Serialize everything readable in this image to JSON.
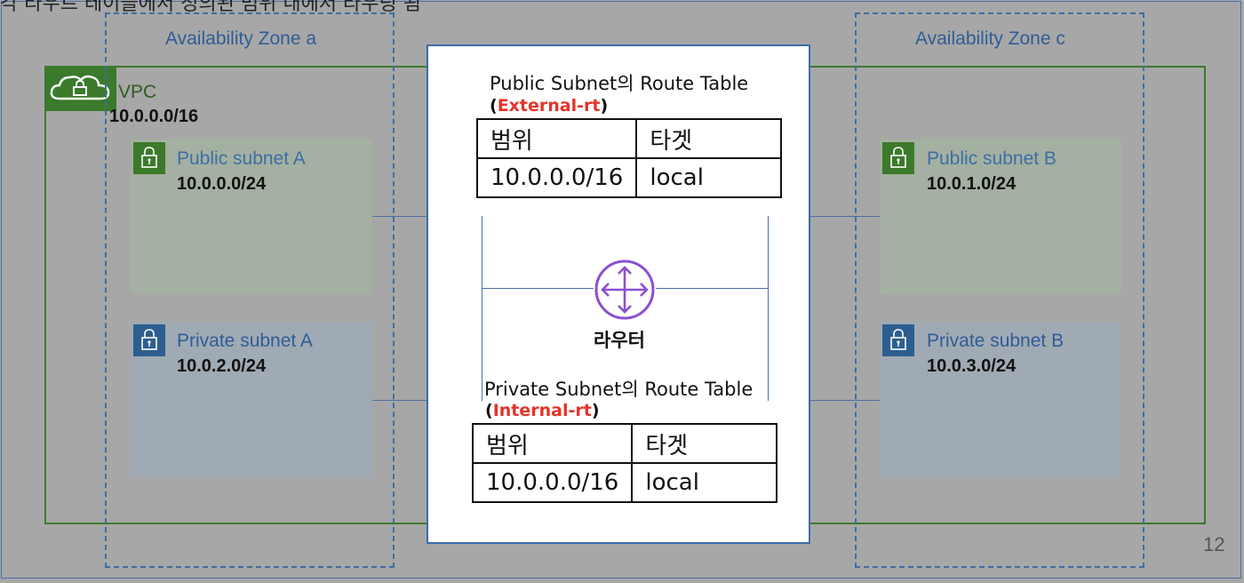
{
  "header": {
    "text": "각 라우트 테이블에서 정의된 범위 내에서 라우팅 됨"
  },
  "zones": [
    {
      "label": "Availability Zone a"
    },
    {
      "label": "Availability Zone c"
    }
  ],
  "vpc": {
    "label": "VPC",
    "cidr": "10.0.0.0/16",
    "icon": "vpc-cloud-lock-icon"
  },
  "subnets": [
    {
      "label": "Public subnet A",
      "cidr": "10.0.0.0/24",
      "icon": "lock-icon"
    },
    {
      "label": "Private subnet A",
      "cidr": "10.0.2.0/24",
      "icon": "lock-icon"
    },
    {
      "label": "Public subnet B",
      "cidr": "10.0.1.0/24",
      "icon": "lock-icon"
    },
    {
      "label": "Private subnet B",
      "cidr": "10.0.3.0/24",
      "icon": "lock-icon"
    }
  ],
  "route_tables": [
    {
      "title": "Public Subnet의 Route Table",
      "paren_open": "(",
      "name": "External-rt",
      "paren_close": ")",
      "headers": [
        "범위",
        "타겟"
      ],
      "rows": [
        [
          "10.0.0.0/16",
          "local"
        ]
      ]
    },
    {
      "title": "Private Subnet의 Route Table",
      "paren_open": "(",
      "name": "Internal-rt",
      "paren_close": ")",
      "headers": [
        "범위",
        "타겟"
      ],
      "rows": [
        [
          "10.0.0.0/16",
          "local"
        ]
      ]
    }
  ],
  "router": {
    "label": "라우터",
    "icon": "router-icon"
  },
  "page_number": "12",
  "colors": {
    "vpc_green": "#3b7a2b",
    "zone_blue": "#3c6ea6",
    "router_purple": "#8c4fd1",
    "highlight_red": "#e4342a"
  }
}
